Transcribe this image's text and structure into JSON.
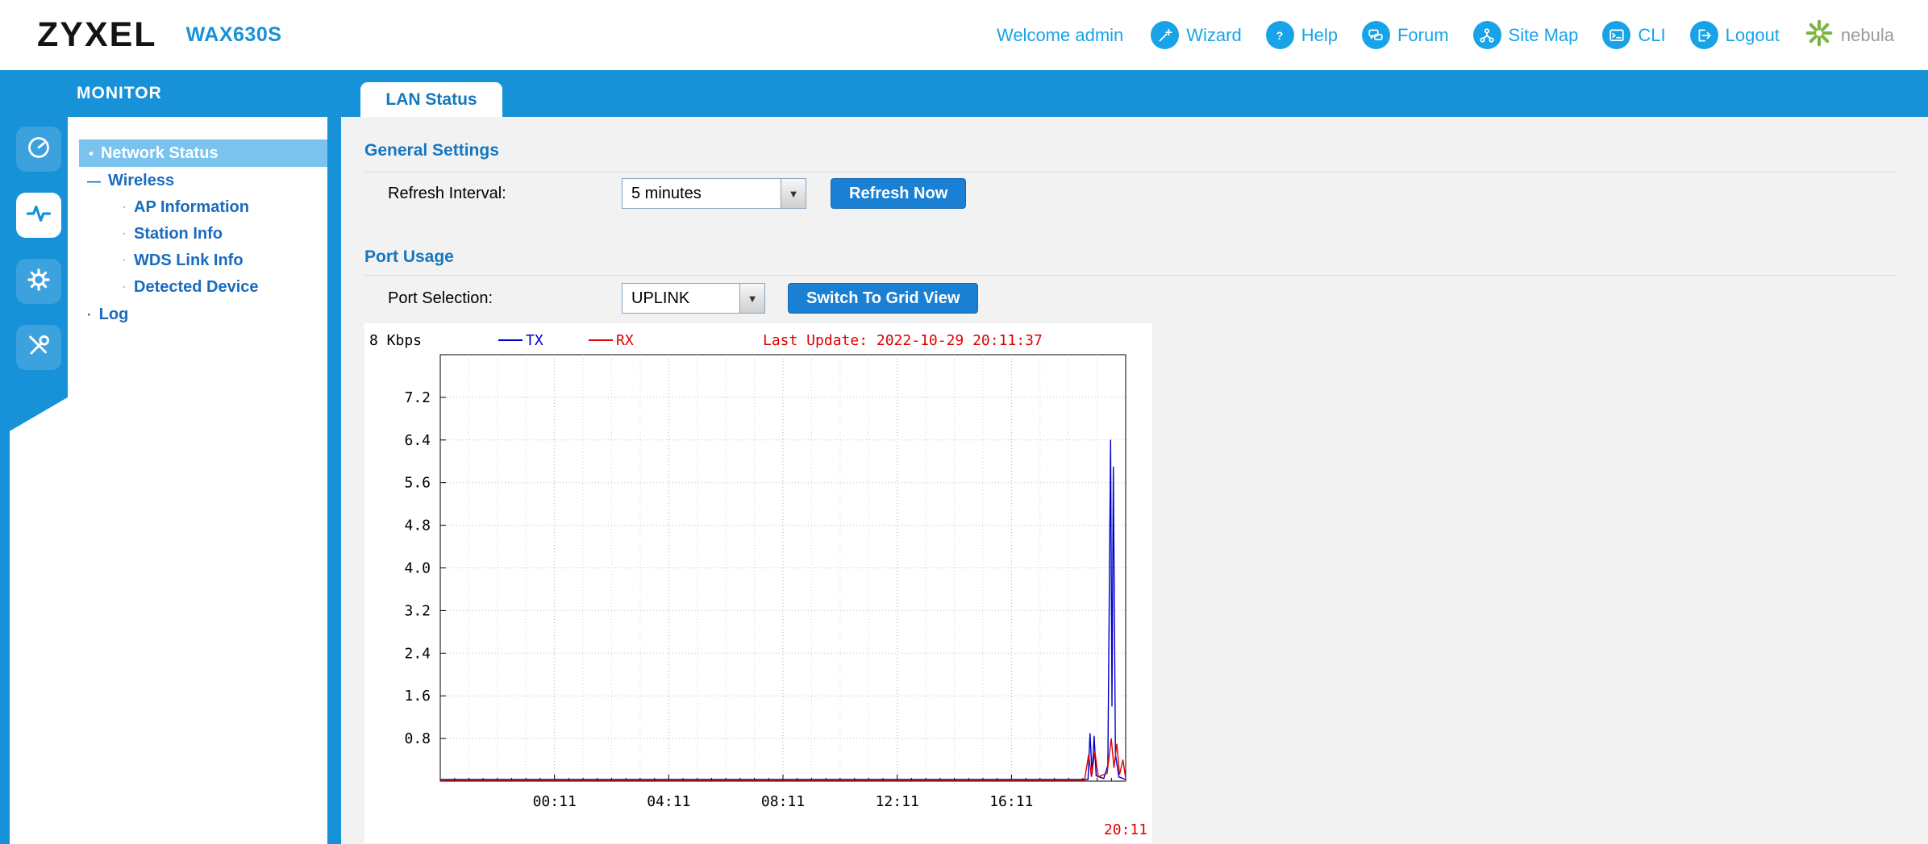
{
  "header": {
    "brand": "ZYXEL",
    "model": "WAX630S",
    "welcome": "Welcome admin",
    "links": [
      {
        "label": "Wizard",
        "icon": "wizard-icon"
      },
      {
        "label": "Help",
        "icon": "help-icon"
      },
      {
        "label": "Forum",
        "icon": "forum-icon"
      },
      {
        "label": "Site Map",
        "icon": "sitemap-icon"
      },
      {
        "label": "CLI",
        "icon": "cli-icon"
      },
      {
        "label": "Logout",
        "icon": "logout-icon"
      }
    ],
    "nebula_label": "nebula"
  },
  "colors": {
    "primary_blue": "#1791d8",
    "link_blue": "#18a3e8",
    "heading_blue": "#1577be",
    "nav_blue": "#1a6bbf",
    "selected_bg": "#79c3ee",
    "button_blue": "#1a80d4",
    "alert_red": "#e00000",
    "tx_blue": "#0000cc",
    "rx_red": "#dd0000",
    "nebula_green": "#7cb342"
  },
  "tabbar": {
    "monitor": "MONITOR",
    "tab": "LAN Status"
  },
  "sidebar": {
    "rail": [
      {
        "name": "dashboard-icon",
        "active": false
      },
      {
        "name": "monitor-icon",
        "active": true
      },
      {
        "name": "configuration-icon",
        "active": false
      },
      {
        "name": "maintenance-icon",
        "active": false
      }
    ],
    "items": [
      {
        "label": "Network Status",
        "level": 1,
        "selected": true,
        "prefix": "•"
      },
      {
        "label": "Wireless",
        "level": 1,
        "selected": false,
        "prefix": "—"
      },
      {
        "label": "AP Information",
        "level": 2,
        "selected": false,
        "prefix": "·"
      },
      {
        "label": "Station Info",
        "level": 2,
        "selected": false,
        "prefix": "·"
      },
      {
        "label": "WDS Link Info",
        "level": 2,
        "selected": false,
        "prefix": "·"
      },
      {
        "label": "Detected Device",
        "level": 2,
        "selected": false,
        "prefix": "·"
      },
      {
        "label": "Log",
        "level": 1,
        "selected": false,
        "prefix": "·"
      }
    ]
  },
  "general": {
    "heading": "General Settings",
    "refresh_label": "Refresh Interval:",
    "refresh_value": "5 minutes",
    "refresh_button": "Refresh Now"
  },
  "port": {
    "heading": "Port Usage",
    "selection_label": "Port Selection:",
    "selection_value": "UPLINK",
    "grid_button": "Switch To Grid View"
  },
  "chart_data": {
    "type": "line",
    "y_axis_title": "8 Kbps",
    "ylim": [
      0,
      8
    ],
    "yticks": [
      "7.2",
      "6.4",
      "5.6",
      "4.8",
      "4.0",
      "3.2",
      "2.4",
      "1.6",
      "0.8"
    ],
    "xticks": [
      {
        "label": "00:11",
        "f": 0.1667
      },
      {
        "label": "04:11",
        "f": 0.3333
      },
      {
        "label": "08:11",
        "f": 0.5
      },
      {
        "label": "12:11",
        "f": 0.6667
      },
      {
        "label": "16:11",
        "f": 0.8333
      }
    ],
    "x_end_label": "20:11",
    "x_span_hours": 24,
    "last_update": "Last Update: 2022-10-29 20:11:37",
    "grid": true,
    "legend_position": "top",
    "series": [
      {
        "name": "TX",
        "color": "#0000cc",
        "points": [
          [
            0,
            0.03
          ],
          [
            0.94,
            0.03
          ],
          [
            0.945,
            0.03
          ],
          [
            0.948,
            0.9
          ],
          [
            0.951,
            0.12
          ],
          [
            0.954,
            0.85
          ],
          [
            0.957,
            0.1
          ],
          [
            0.968,
            0.05
          ],
          [
            0.974,
            0.3
          ],
          [
            0.978,
            6.4
          ],
          [
            0.98,
            1.4
          ],
          [
            0.982,
            5.9
          ],
          [
            0.985,
            0.5
          ],
          [
            0.99,
            0.08
          ],
          [
            1,
            0.03
          ]
        ]
      },
      {
        "name": "RX",
        "color": "#dd0000",
        "points": [
          [
            0,
            0.02
          ],
          [
            0.94,
            0.02
          ],
          [
            0.946,
            0.5
          ],
          [
            0.95,
            0.08
          ],
          [
            0.955,
            0.55
          ],
          [
            0.96,
            0.08
          ],
          [
            0.973,
            0.15
          ],
          [
            0.979,
            0.8
          ],
          [
            0.983,
            0.25
          ],
          [
            0.987,
            0.7
          ],
          [
            0.991,
            0.12
          ],
          [
            0.996,
            0.4
          ],
          [
            1,
            0.05
          ]
        ]
      }
    ]
  }
}
